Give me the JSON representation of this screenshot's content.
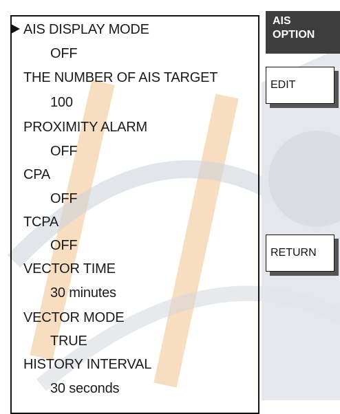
{
  "menu": {
    "items": [
      {
        "label": "AIS DISPLAY MODE",
        "value": "OFF"
      },
      {
        "label": "THE NUMBER OF AIS TARGET",
        "value": "100"
      },
      {
        "label": "PROXIMITY ALARM",
        "value": "OFF"
      },
      {
        "label": "CPA",
        "value": "OFF"
      },
      {
        "label": "TCPA",
        "value": "OFF"
      },
      {
        "label": "VECTOR TIME",
        "value": "30 minutes"
      },
      {
        "label": "VECTOR MODE",
        "value": "TRUE"
      },
      {
        "label": "HISTORY INTERVAL",
        "value": "30 seconds"
      }
    ],
    "selected_index": 0
  },
  "sidebar": {
    "title_line1": "AIS",
    "title_line2": "OPTION",
    "edit_label": "EDIT",
    "return_label": "RETURN"
  }
}
